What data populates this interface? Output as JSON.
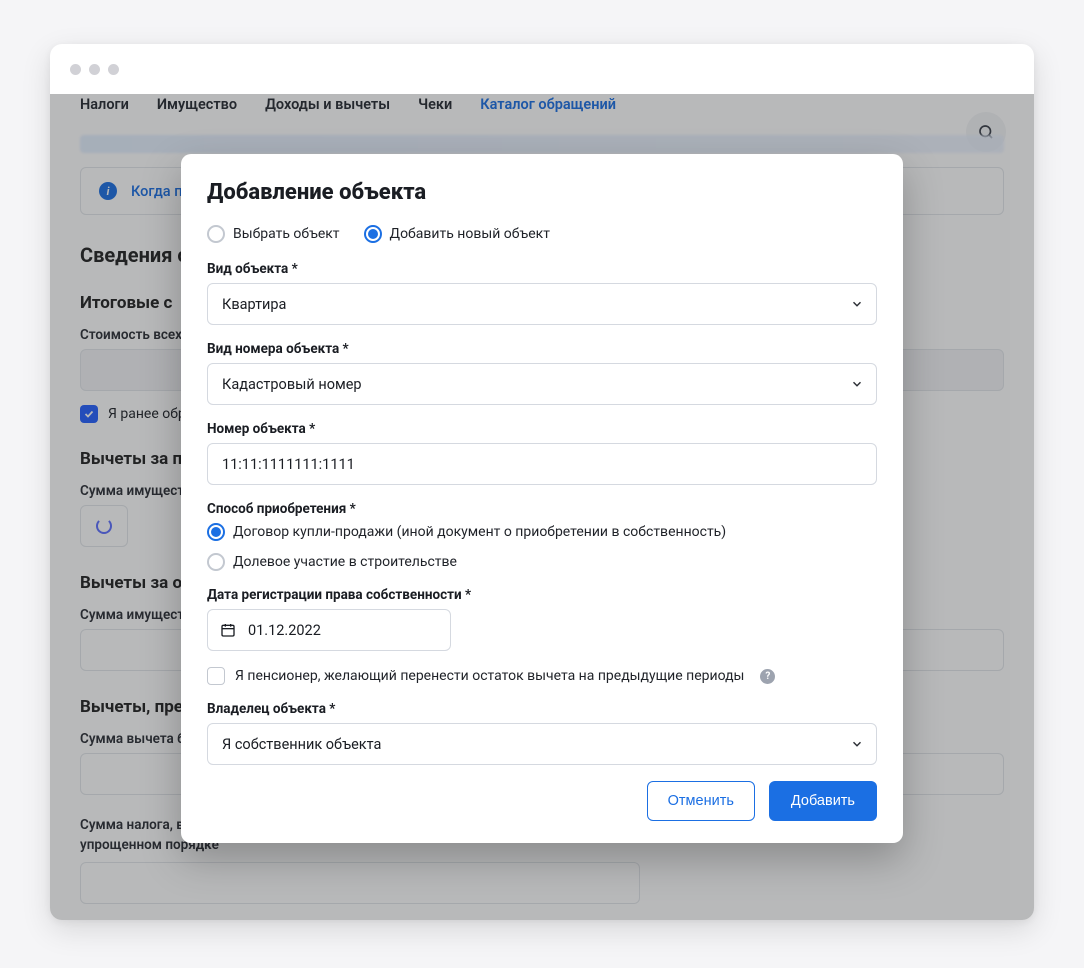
{
  "nav": {
    "items": [
      "Налоги",
      "Имущество",
      "Доходы и вычеты",
      "Чеки",
      "Каталог обращений"
    ],
    "active_index": 4
  },
  "background": {
    "info_text": "Когда п",
    "section_title": "Сведения о",
    "subsection_itog": "Итоговые с",
    "label_cost_all": "Стоимость всех",
    "check_prev": "Я ранее обра",
    "subsection_prev": "Вычеты за пр",
    "label_sum_prop": "Сумма имущест",
    "subsection_report": "Вычеты за отч",
    "label_sum_prop2": "Сумма имущест",
    "subsection_provided": "Вычеты, пред",
    "label_sum_deduct": "Сумма вычета б",
    "label_tax_returned": "Сумма налога, возвращенная (зачтенная) в связи с применением вычета в упрощенном порядке"
  },
  "modal": {
    "title": "Добавление объекта",
    "radio_select": "Выбрать объект",
    "radio_add": "Добавить новый объект",
    "label_obj_type": "Вид объекта *",
    "obj_type_value": "Квартира",
    "label_num_type": "Вид номера объекта *",
    "num_type_value": "Кадастровый номер",
    "label_obj_num": "Номер объекта *",
    "obj_num_value": "11:11:1111111:1111",
    "label_method": "Способ приобретения *",
    "method_opt1": "Договор купли-продажи (иной документ о приобретении в собственность)",
    "method_opt2": "Долевое участие в строительстве",
    "label_reg_date": "Дата регистрации права собственности *",
    "reg_date_value": "01.12.2022",
    "pension_check": "Я пенсионер, желающий перенести остаток вычета на предыдущие периоды",
    "label_owner": "Владелец объекта *",
    "owner_value": "Я собственник объекта",
    "btn_cancel": "Отменить",
    "btn_add": "Добавить"
  }
}
